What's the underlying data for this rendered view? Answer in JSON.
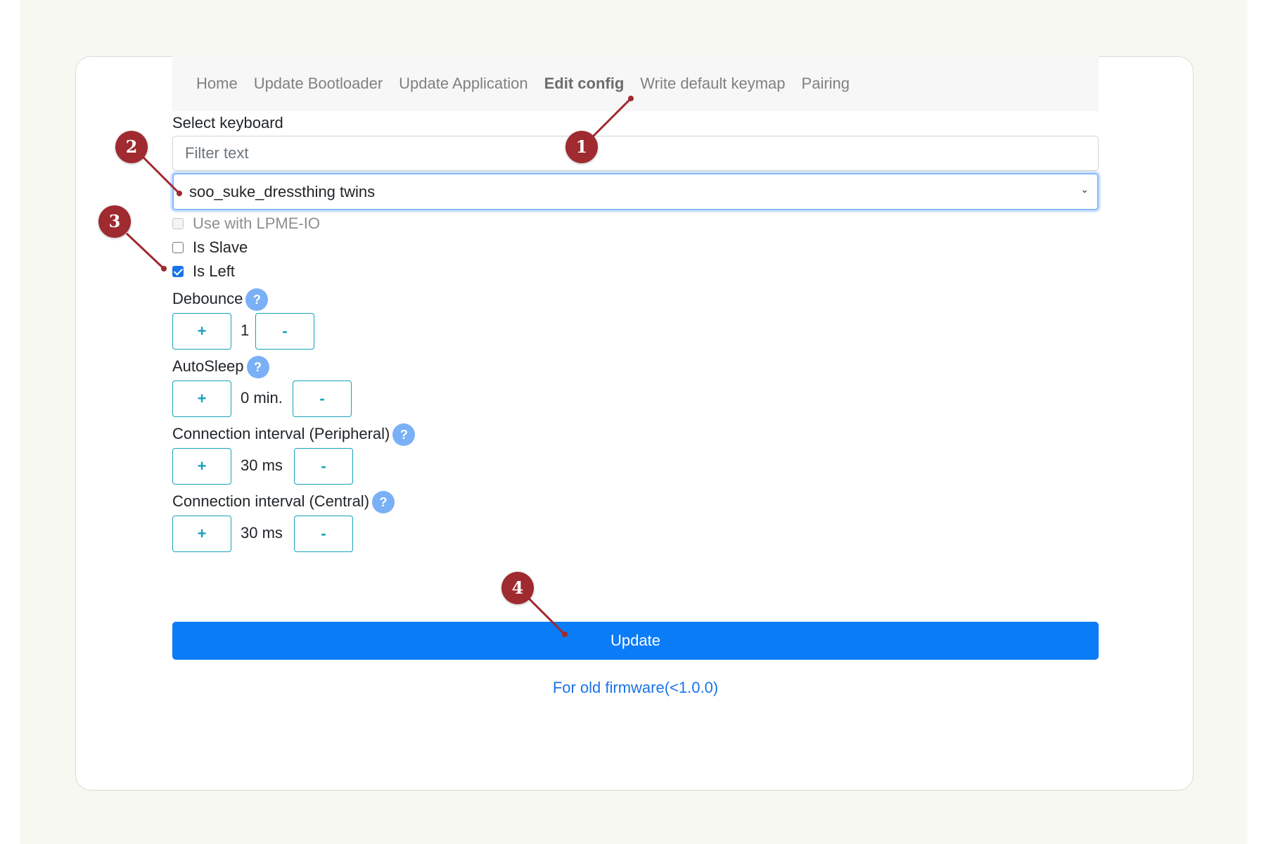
{
  "nav": {
    "items": [
      {
        "label": "Home",
        "active": false
      },
      {
        "label": "Update Bootloader",
        "active": false
      },
      {
        "label": "Update Application",
        "active": false
      },
      {
        "label": "Edit config",
        "active": true
      },
      {
        "label": "Write default keymap",
        "active": false
      },
      {
        "label": "Pairing",
        "active": false
      }
    ]
  },
  "keyboard": {
    "label": "Select keyboard",
    "filter_placeholder": "Filter text",
    "selected": "soo_suke_dressthing twins"
  },
  "options": {
    "lpme": {
      "label": "Use with LPME-IO",
      "checked": false,
      "disabled": true
    },
    "slave": {
      "label": "Is Slave",
      "checked": false
    },
    "left": {
      "label": "Is Left",
      "checked": true
    }
  },
  "settings": {
    "debounce": {
      "label": "Debounce",
      "value": "1"
    },
    "autosleep": {
      "label": "AutoSleep",
      "value": "0 min."
    },
    "peripheral": {
      "label": "Connection interval (Peripheral)",
      "value": "30 ms"
    },
    "central": {
      "label": "Connection interval (Central)",
      "value": "30 ms"
    },
    "plus": "+",
    "minus": "-",
    "help": "?"
  },
  "actions": {
    "update": "Update",
    "old_firmware": "For old firmware(<1.0.0)"
  },
  "annotations": [
    "1",
    "2",
    "3",
    "4"
  ],
  "colors": {
    "primary": "#0b7cf7",
    "outline": "#17a2b8",
    "badge": "#9f2a2f",
    "help": "#7ab0f5"
  }
}
